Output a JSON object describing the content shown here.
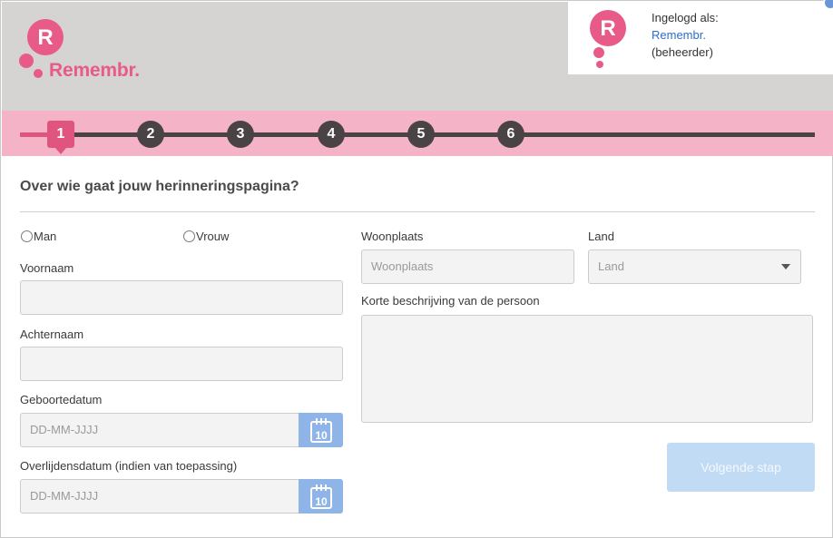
{
  "brand": {
    "name": "Remembr.",
    "logo_letter": "R",
    "color": "#e85a88"
  },
  "user": {
    "logged_in_label": "Ingelogd als:",
    "name": "Remembr.",
    "role": "(beheerder)"
  },
  "steps": [
    {
      "label": "1",
      "active": true
    },
    {
      "label": "2",
      "active": false
    },
    {
      "label": "3",
      "active": false
    },
    {
      "label": "4",
      "active": false
    },
    {
      "label": "5",
      "active": false
    },
    {
      "label": "6",
      "active": false
    }
  ],
  "form": {
    "title": "Over wie gaat jouw herinneringspagina?",
    "gender": {
      "option_male": "Man",
      "option_female": "Vrouw"
    },
    "first_name": {
      "label": "Voornaam",
      "value": ""
    },
    "last_name": {
      "label": "Achternaam",
      "value": ""
    },
    "birth_date": {
      "label": "Geboortedatum",
      "placeholder": "DD-MM-JJJJ"
    },
    "death_date": {
      "label": "Overlijdensdatum (indien van toepassing)",
      "placeholder": "DD-MM-JJJJ"
    },
    "city": {
      "label": "Woonplaats",
      "placeholder": "Woonplaats"
    },
    "country": {
      "label": "Land",
      "selected": "Land"
    },
    "description": {
      "label": "Korte beschrijving van de persoon",
      "value": ""
    },
    "calendar_day": "10",
    "next_button": "Volgende stap"
  },
  "colors": {
    "header_bg": "#d6d3d3",
    "stepbar_bg": "#f5b3c8",
    "accent": "#e0557f",
    "step_inactive": "#4a4345",
    "calendar_btn": "#8fb5e8",
    "next_btn_disabled": "#c2dbf4"
  }
}
